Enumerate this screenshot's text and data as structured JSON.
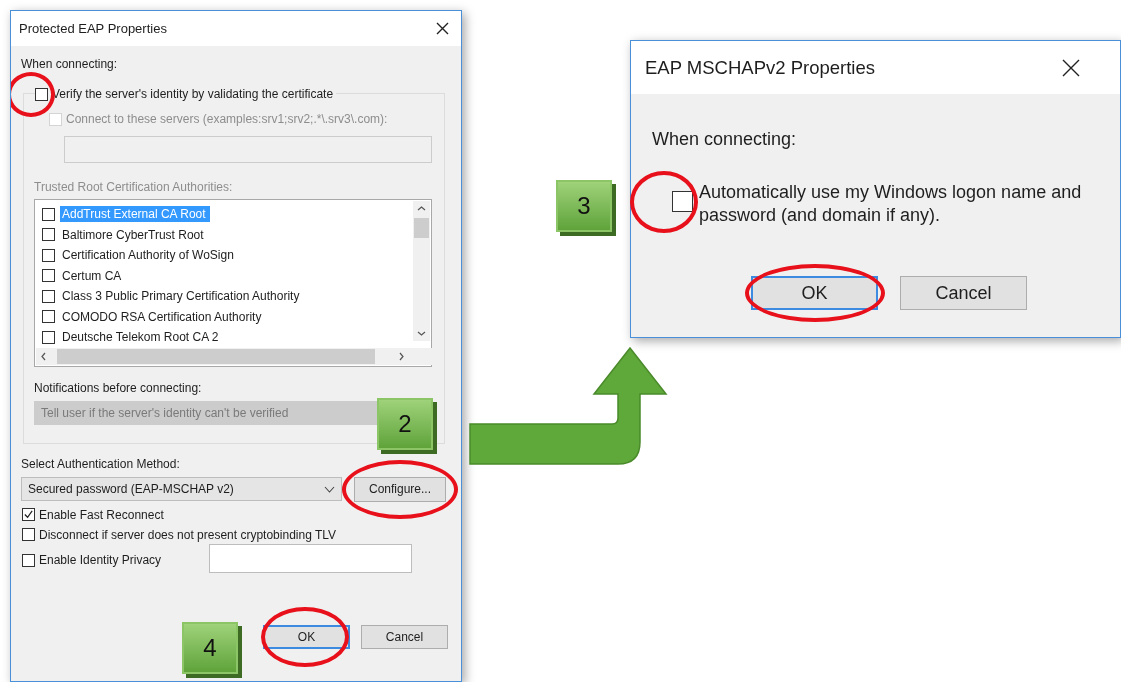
{
  "peap_dialog": {
    "title": "Protected EAP Properties",
    "section_label": "When connecting:",
    "verify_checkbox": {
      "label": "Verify the server's identity by validating the certificate",
      "checked": false,
      "highlighted": true
    },
    "connect_checkbox": {
      "label": "Connect to these servers (examples:srv1;srv2;.*\\.srv3\\.com):",
      "checked": false,
      "disabled": true
    },
    "servers_field": {
      "disabled": true
    },
    "trusted_ca_label": "Trusted Root Certification Authorities:",
    "trusted_ca_list": [
      {
        "name": "AddTrust External CA Root",
        "checked": false,
        "selected": true
      },
      {
        "name": "Baltimore CyberTrust Root",
        "checked": false,
        "selected": false
      },
      {
        "name": "Certification Authority of WoSign",
        "checked": false,
        "selected": false
      },
      {
        "name": "Certum CA",
        "checked": false,
        "selected": false
      },
      {
        "name": "Class 3 Public Primary Certification Authority",
        "checked": false,
        "selected": false
      },
      {
        "name": "COMODO RSA Certification Authority",
        "checked": false,
        "selected": false
      },
      {
        "name": "Deutsche Telekom Root CA 2",
        "checked": false,
        "selected": false
      }
    ],
    "notifications_label": "Notifications before connecting:",
    "notifications_dropdown": {
      "value": "Tell user if the server's identity can't be verified",
      "disabled": true
    },
    "auth_method_label": "Select Authentication Method:",
    "auth_method_dropdown": {
      "value": "Secured password (EAP-MSCHAP v2)"
    },
    "configure_button": {
      "label": "Configure...",
      "highlighted": true
    },
    "options": [
      {
        "kind": "checkbox",
        "label": "Enable Fast Reconnect",
        "checked": true
      },
      {
        "kind": "checkbox",
        "label": "Disconnect if server does not present cryptobinding TLV",
        "checked": false
      },
      {
        "kind": "checkbox_field",
        "label": "Enable Identity Privacy",
        "checked": false
      }
    ],
    "buttons": [
      {
        "label": "OK",
        "default": true,
        "highlighted": true
      },
      {
        "label": "Cancel",
        "default": false,
        "highlighted": false
      }
    ]
  },
  "mschap_dialog": {
    "title": "EAP MSCHAPv2 Properties",
    "section_label": "When connecting:",
    "auto_logon_checkbox": {
      "label": "Automatically use my Windows logon name and password (and domain if any).",
      "checked": false,
      "highlighted": true
    },
    "buttons": [
      {
        "label": "OK",
        "default": true,
        "highlighted": true
      },
      {
        "label": "Cancel",
        "default": false,
        "highlighted": false
      }
    ]
  },
  "step_badges": [
    {
      "label": "2"
    },
    {
      "label": "3"
    },
    {
      "label": "4"
    }
  ]
}
